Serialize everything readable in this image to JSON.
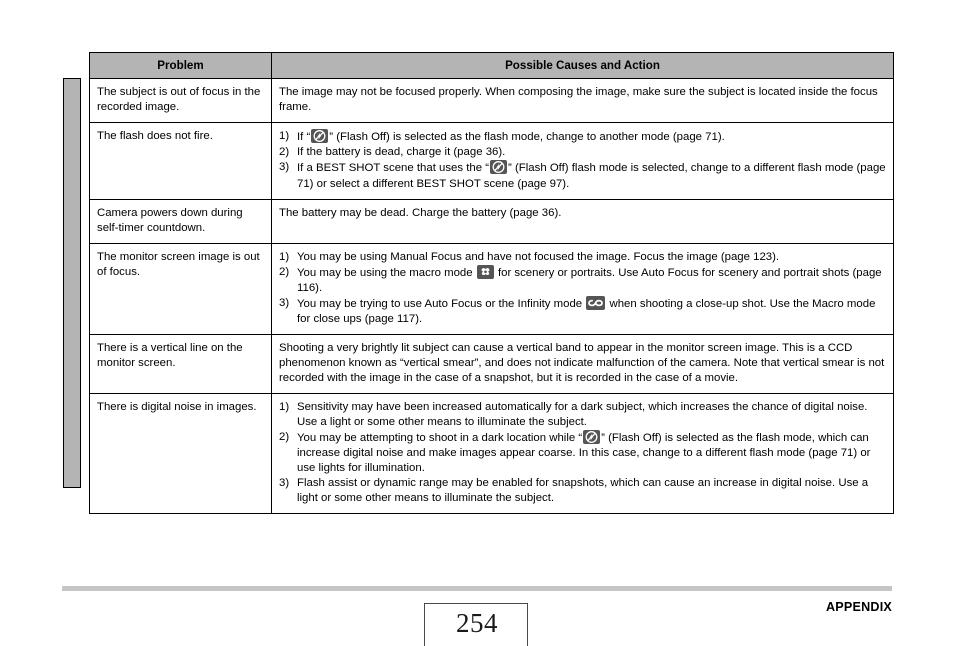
{
  "document": {
    "page_number": "254",
    "section_label": "APPENDIX"
  },
  "table": {
    "headers": {
      "problem": "Problem",
      "cause": "Possible Causes and Action"
    },
    "rows": [
      {
        "problem": "The subject is out of focus in the recorded image.",
        "cause_paragraph": "The image may not be focused properly. When composing the image, make sure the subject is located inside the focus frame."
      },
      {
        "problem": "The flash does not fire.",
        "items": [
          {
            "num": "1)",
            "pre": "If “",
            "icon": "flash-off-icon",
            "post": "” (Flash Off) is selected as the flash mode, change to another mode (page 71)."
          },
          {
            "num": "2)",
            "pre": "If the battery is dead, charge it (page 36)."
          },
          {
            "num": "3)",
            "pre": "If a BEST SHOT scene that uses the “",
            "icon": "flash-off-icon",
            "post": "” (Flash Off) flash mode is selected, change to a different flash mode (page 71) or select a different BEST SHOT scene (page 97)."
          }
        ]
      },
      {
        "problem": "Camera powers down during self-timer countdown.",
        "cause_paragraph": "The battery may be dead. Charge the battery (page 36)."
      },
      {
        "problem": "The monitor screen image is out of focus.",
        "items": [
          {
            "num": "1)",
            "pre": "You may be using Manual Focus and have not focused the image. Focus the image (page 123)."
          },
          {
            "num": "2)",
            "pre": "You may be using the macro mode",
            "icon": "macro-mode-icon",
            "post": "for scenery or portraits. Use Auto Focus for scenery and portrait shots (page 116)."
          },
          {
            "num": "3)",
            "pre": "You may be trying to use Auto Focus or the Infinity mode",
            "icon": "infinity-mode-icon",
            "post": "when shooting a close-up shot. Use the Macro mode for close ups (page 117)."
          }
        ]
      },
      {
        "problem": "There is a vertical line on the monitor screen.",
        "cause_paragraph": "Shooting a very brightly lit subject can cause a vertical band to appear in the monitor screen image. This is a CCD phenomenon known as “vertical smear”, and does not indicate malfunction of the camera. Note that vertical smear is not recorded with the image in the case of a snapshot, but it is recorded in the case of a movie."
      },
      {
        "problem": "There is digital noise in images.",
        "items": [
          {
            "num": "1)",
            "pre": "Sensitivity may have been increased automatically for a dark subject, which increases the chance of digital noise. Use a light or some other means to illuminate the subject."
          },
          {
            "num": "2)",
            "pre": "You may be attempting to shoot in a dark location while “",
            "icon": "flash-off-icon",
            "post": "” (Flash Off) is selected as the flash mode, which can increase digital noise and make images appear coarse. In this case, change to a different flash mode (page 71) or use lights for illumination."
          },
          {
            "num": "3)",
            "pre": "Flash assist or dynamic range may be enabled for snapshots, which can cause an increase in digital noise. Use a light or some other means to illuminate the subject."
          }
        ]
      }
    ]
  },
  "colors": {
    "header_fill": "#b4b4b4",
    "side_tab_fill": "#b4b4b4",
    "footer_rule": "#c6c6c6",
    "icon_fill": "#555555",
    "border": "#000000"
  }
}
